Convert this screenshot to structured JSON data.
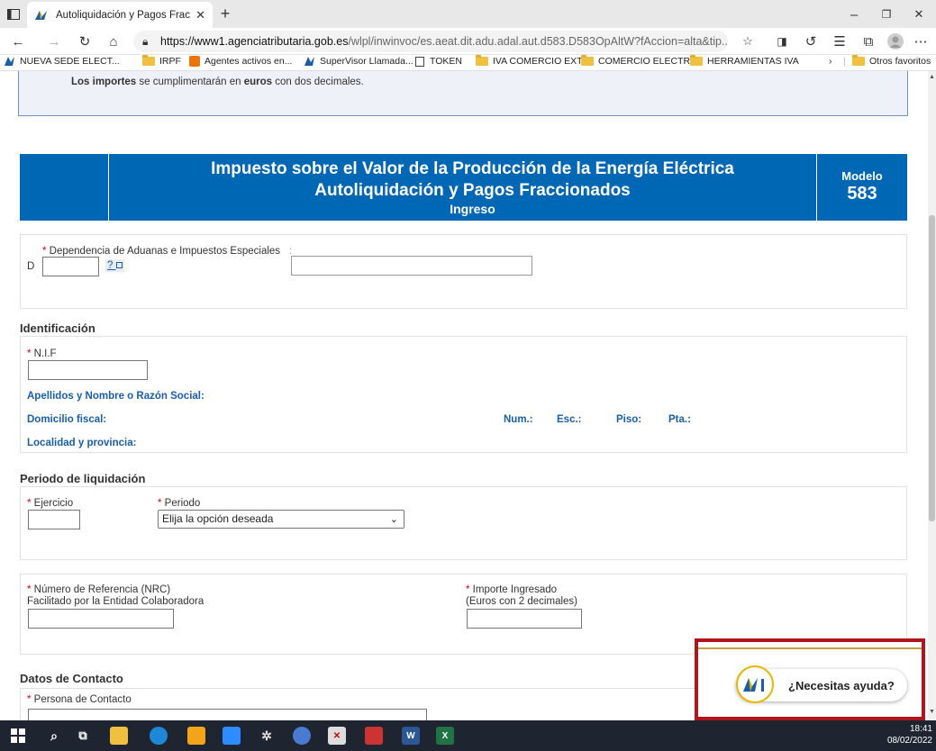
{
  "browser": {
    "tab_title": "Autoliquidación y Pagos Fraccion",
    "url_domain": "https://www1.agenciatributaria.gob.es",
    "url_path": "/wlpl/inwinvoc/es.aeat.dit.adu.adal.aut.d583.D583OpAltW?fAccion=alta&tip...",
    "bookmarks": [
      {
        "label": "NUEVA SEDE ELECT...",
        "icon": "aeat-icon"
      },
      {
        "label": "IRPF",
        "icon": "folder-icon"
      },
      {
        "label": "Agentes activos en...",
        "icon": "orange-icon"
      },
      {
        "label": "SuperVisor Llamada...",
        "icon": "aeat-icon"
      },
      {
        "label": "TOKEN",
        "icon": "page-icon"
      },
      {
        "label": "IVA COMERCIO EXT...",
        "icon": "folder-icon"
      },
      {
        "label": "COMERCIO ELECTR...",
        "icon": "folder-icon"
      },
      {
        "label": "HERRAMIENTAS IVA",
        "icon": "folder-icon"
      }
    ],
    "other_favorites": "Otros favoritos"
  },
  "info": {
    "pre": "Los importes",
    "mid": " se cumplimentarán en ",
    "bold2": "euros",
    "post": " con dos decimales."
  },
  "banner": {
    "line1": "Impuesto sobre el Valor de la Producción de la Energía Eléctrica",
    "line2": "Autoliquidación y Pagos Fraccionados",
    "line3": "Ingreso",
    "modelo_label": "Modelo",
    "modelo_number": "583"
  },
  "dependencia": {
    "label": "Dependencia de Aduanas e Impuestos Especiales",
    "colon": ":",
    "prefix": "D",
    "help": "?"
  },
  "identificacion": {
    "heading": "Identificación",
    "nif_label": "N.I.F",
    "apellidos": "Apellidos y Nombre o Razón Social:",
    "domicilio": "Domicilio fiscal:",
    "num": "Num.:",
    "esc": "Esc.:",
    "piso": "Piso:",
    "pta": "Pta.:",
    "localidad": "Localidad y provincia:"
  },
  "periodo": {
    "heading": "Periodo de liquidación",
    "ejercicio_label": "Ejercicio",
    "periodo_label": "Periodo",
    "periodo_value": "Elija la opción deseada"
  },
  "pago": {
    "nrc_label1": "Número de Referencia (NRC)",
    "nrc_label2": "Facilitado por la Entidad Colaboradora",
    "importe_label1": "Importe Ingresado",
    "importe_label2": "(Euros con 2 decimales)"
  },
  "contacto": {
    "heading": "Datos de Contacto",
    "persona_label": "Persona de Contacto"
  },
  "help_widget": {
    "logo": "AEAT",
    "text": "¿Necesitas ayuda?"
  },
  "taskbar": {
    "time": "18:41",
    "date": "08/02/2022"
  },
  "colors": {
    "banner": "#0067b4",
    "required": "#dd0000",
    "blue_label": "#1a5eaa",
    "help_border": "#b3141c"
  }
}
